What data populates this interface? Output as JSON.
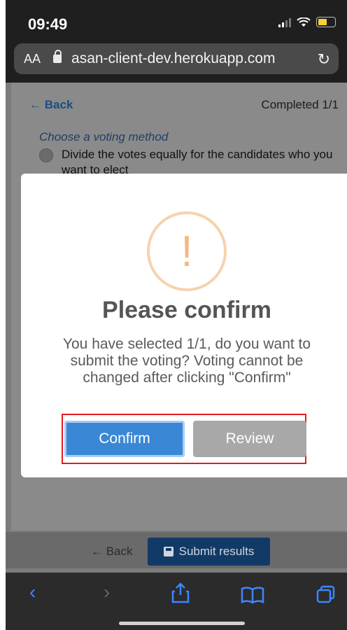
{
  "status_bar": {
    "time": "09:49"
  },
  "browser": {
    "text_size_label": "AA",
    "url": "asan-client-dev.herokuapp.com"
  },
  "page": {
    "back_label": "← Back",
    "completed_label": "Completed 1/1",
    "voting_method_label": "Choose a voting method",
    "option_text": "Divide the votes equally for the candidates who you want to elect"
  },
  "modal": {
    "title": "Please confirm",
    "message": "You have selected 1/1, do you want to submit the voting? Voting cannot be changed after clicking \"Confirm\"",
    "confirm_label": "Confirm",
    "review_label": "Review",
    "icon_glyph": "!"
  },
  "footer": {
    "back_label": "← Back",
    "submit_label": "Submit results"
  },
  "colors": {
    "primary": "#3a87d6",
    "secondary": "#a8a8a8",
    "highlight": "#e31b23",
    "warning": "#f5b77f"
  }
}
